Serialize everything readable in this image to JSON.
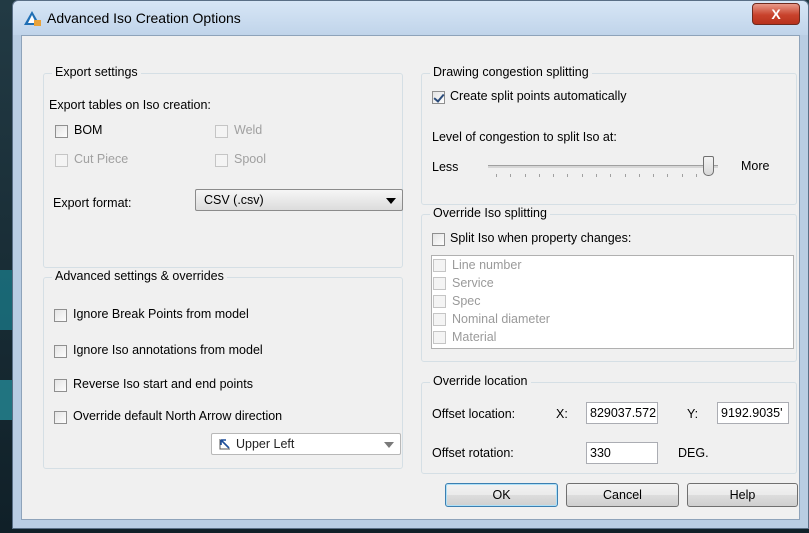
{
  "window": {
    "title": "Advanced Iso Creation Options",
    "close_glyph": "X"
  },
  "export_settings": {
    "legend": "Export settings",
    "tables_label": "Export tables on Iso creation:",
    "bom": "BOM",
    "weld": "Weld",
    "cut_piece": "Cut Piece",
    "spool": "Spool",
    "format_label": "Export format:",
    "format_value": "CSV (.csv)"
  },
  "advanced": {
    "legend": "Advanced settings & overrides",
    "ignore_break_points": "Ignore Break Points from model",
    "ignore_annotations": "Ignore Iso annotations from model",
    "reverse_points": "Reverse Iso start and end points",
    "override_north_arrow": "Override default North Arrow direction",
    "north_arrow_value": "Upper Left"
  },
  "congestion": {
    "legend": "Drawing congestion splitting",
    "create_split": "Create split points automatically",
    "level_label": "Level of congestion to split Iso at:",
    "less": "Less",
    "more": "More",
    "slider_level": 1.0
  },
  "override_split": {
    "legend": "Override Iso splitting",
    "split_label": "Split Iso when property changes:",
    "properties": [
      "Line number",
      "Service",
      "Spec",
      "Nominal diameter",
      "Material"
    ]
  },
  "override_location": {
    "legend": "Override location",
    "offset_label": "Offset location:",
    "x_label": "X:",
    "x_value": "829037.572",
    "y_label": "Y:",
    "y_value": "9192.9035'",
    "rotation_label": "Offset rotation:",
    "rotation_value": "330",
    "deg_label": "DEG."
  },
  "buttons": {
    "ok": "OK",
    "cancel": "Cancel",
    "help": "Help"
  },
  "colors": {
    "titlebar": "#c8dbef",
    "close": "#c8422c",
    "dialog_bg": "#f0f0f0",
    "check": "#2c4c7a"
  },
  "icons": {
    "app": "autocad-plant-3d-icon",
    "north_arrow": "north-arrow-icon"
  }
}
